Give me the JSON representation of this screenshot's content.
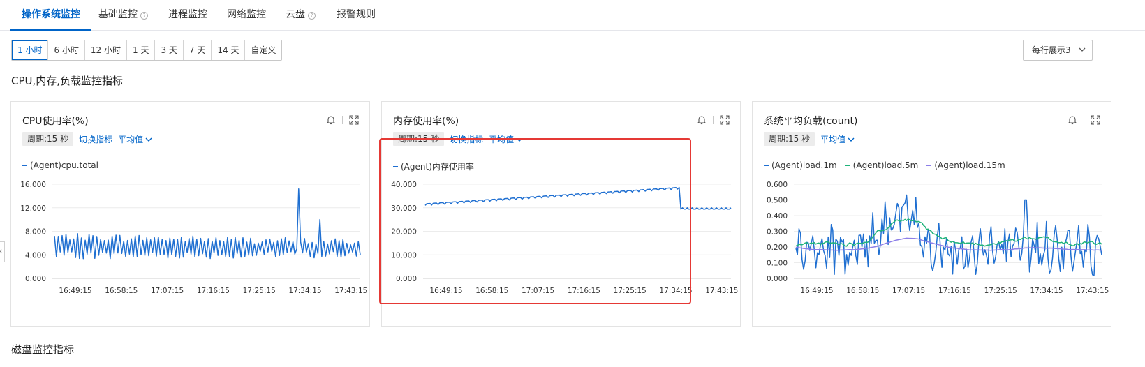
{
  "tabs": [
    {
      "label": "操作系统监控",
      "active": true,
      "help": false
    },
    {
      "label": "基础监控",
      "active": false,
      "help": true
    },
    {
      "label": "进程监控",
      "active": false,
      "help": false
    },
    {
      "label": "网络监控",
      "active": false,
      "help": false
    },
    {
      "label": "云盘",
      "active": false,
      "help": true
    },
    {
      "label": "报警规则",
      "active": false,
      "help": false
    }
  ],
  "time_range": {
    "options": [
      "1 小时",
      "6 小时",
      "12 小时",
      "1 天",
      "3 天",
      "7 天",
      "14 天",
      "自定义"
    ],
    "selected": "1 小时"
  },
  "per_row": {
    "label": "每行展示3"
  },
  "section_title": "CPU,内存,负载监控指标",
  "next_section_title": "磁盘监控指标",
  "colors": {
    "primary": "#0064c8",
    "series_blue": "#1f6fd1",
    "series_green": "#1fb37a",
    "series_purple": "#8c7ee8",
    "highlight": "#e53935"
  },
  "icons": {
    "bell": "bell-icon",
    "fullscreen": "fullscreen-icon",
    "dropdown": "chevron-down-icon"
  },
  "charts": [
    {
      "title": "CPU使用率(%)",
      "period": "周期:15 秒",
      "links": [
        "切换指标",
        "平均值"
      ],
      "chart_data": {
        "type": "line",
        "x": [
          "16:49:15",
          "16:58:15",
          "17:07:15",
          "17:16:15",
          "17:25:15",
          "17:34:15",
          "17:43:15"
        ],
        "yticks": [
          "0.000",
          "4.000",
          "8.000",
          "12.000",
          "16.000"
        ],
        "ylim": [
          0,
          16
        ],
        "series": [
          {
            "name": "(Agent)cpu.total",
            "color": "#1f6fd1",
            "pattern": "cpu",
            "base": 5.5,
            "amp": 1.6,
            "spike": 15.2
          }
        ]
      }
    },
    {
      "title": "内存使用率(%)",
      "period": "周期:15 秒",
      "links": [
        "切换指标",
        "平均值"
      ],
      "chart_data": {
        "type": "line",
        "x": [
          "16:49:15",
          "16:58:15",
          "17:07:15",
          "17:16:15",
          "17:25:15",
          "17:34:15",
          "17:43:15"
        ],
        "yticks": [
          "0.000",
          "10.000",
          "20.000",
          "30.000",
          "40.000"
        ],
        "ylim": [
          0,
          40
        ],
        "series": [
          {
            "name": "(Agent)内存使用率",
            "color": "#1f6fd1",
            "pattern": "mem",
            "start": 31.5,
            "end": 38.5,
            "after": 29.6
          }
        ]
      }
    },
    {
      "title": "系统平均负载(count)",
      "period": "周期:15 秒",
      "links": [
        "平均值"
      ],
      "chart_data": {
        "type": "line",
        "x": [
          "16:49:15",
          "16:58:15",
          "17:07:15",
          "17:16:15",
          "17:25:15",
          "17:34:15",
          "17:43:15"
        ],
        "yticks": [
          "0.000",
          "0.100",
          "0.200",
          "0.300",
          "0.400",
          "0.500",
          "0.600"
        ],
        "ylim": [
          0,
          0.6
        ],
        "series": [
          {
            "name": "(Agent)load.1m",
            "color": "#1f6fd1",
            "pattern": "load1"
          },
          {
            "name": "(Agent)load.5m",
            "color": "#1fb37a",
            "pattern": "load5"
          },
          {
            "name": "(Agent)load.15m",
            "color": "#8c7ee8",
            "pattern": "load15"
          }
        ]
      }
    }
  ]
}
